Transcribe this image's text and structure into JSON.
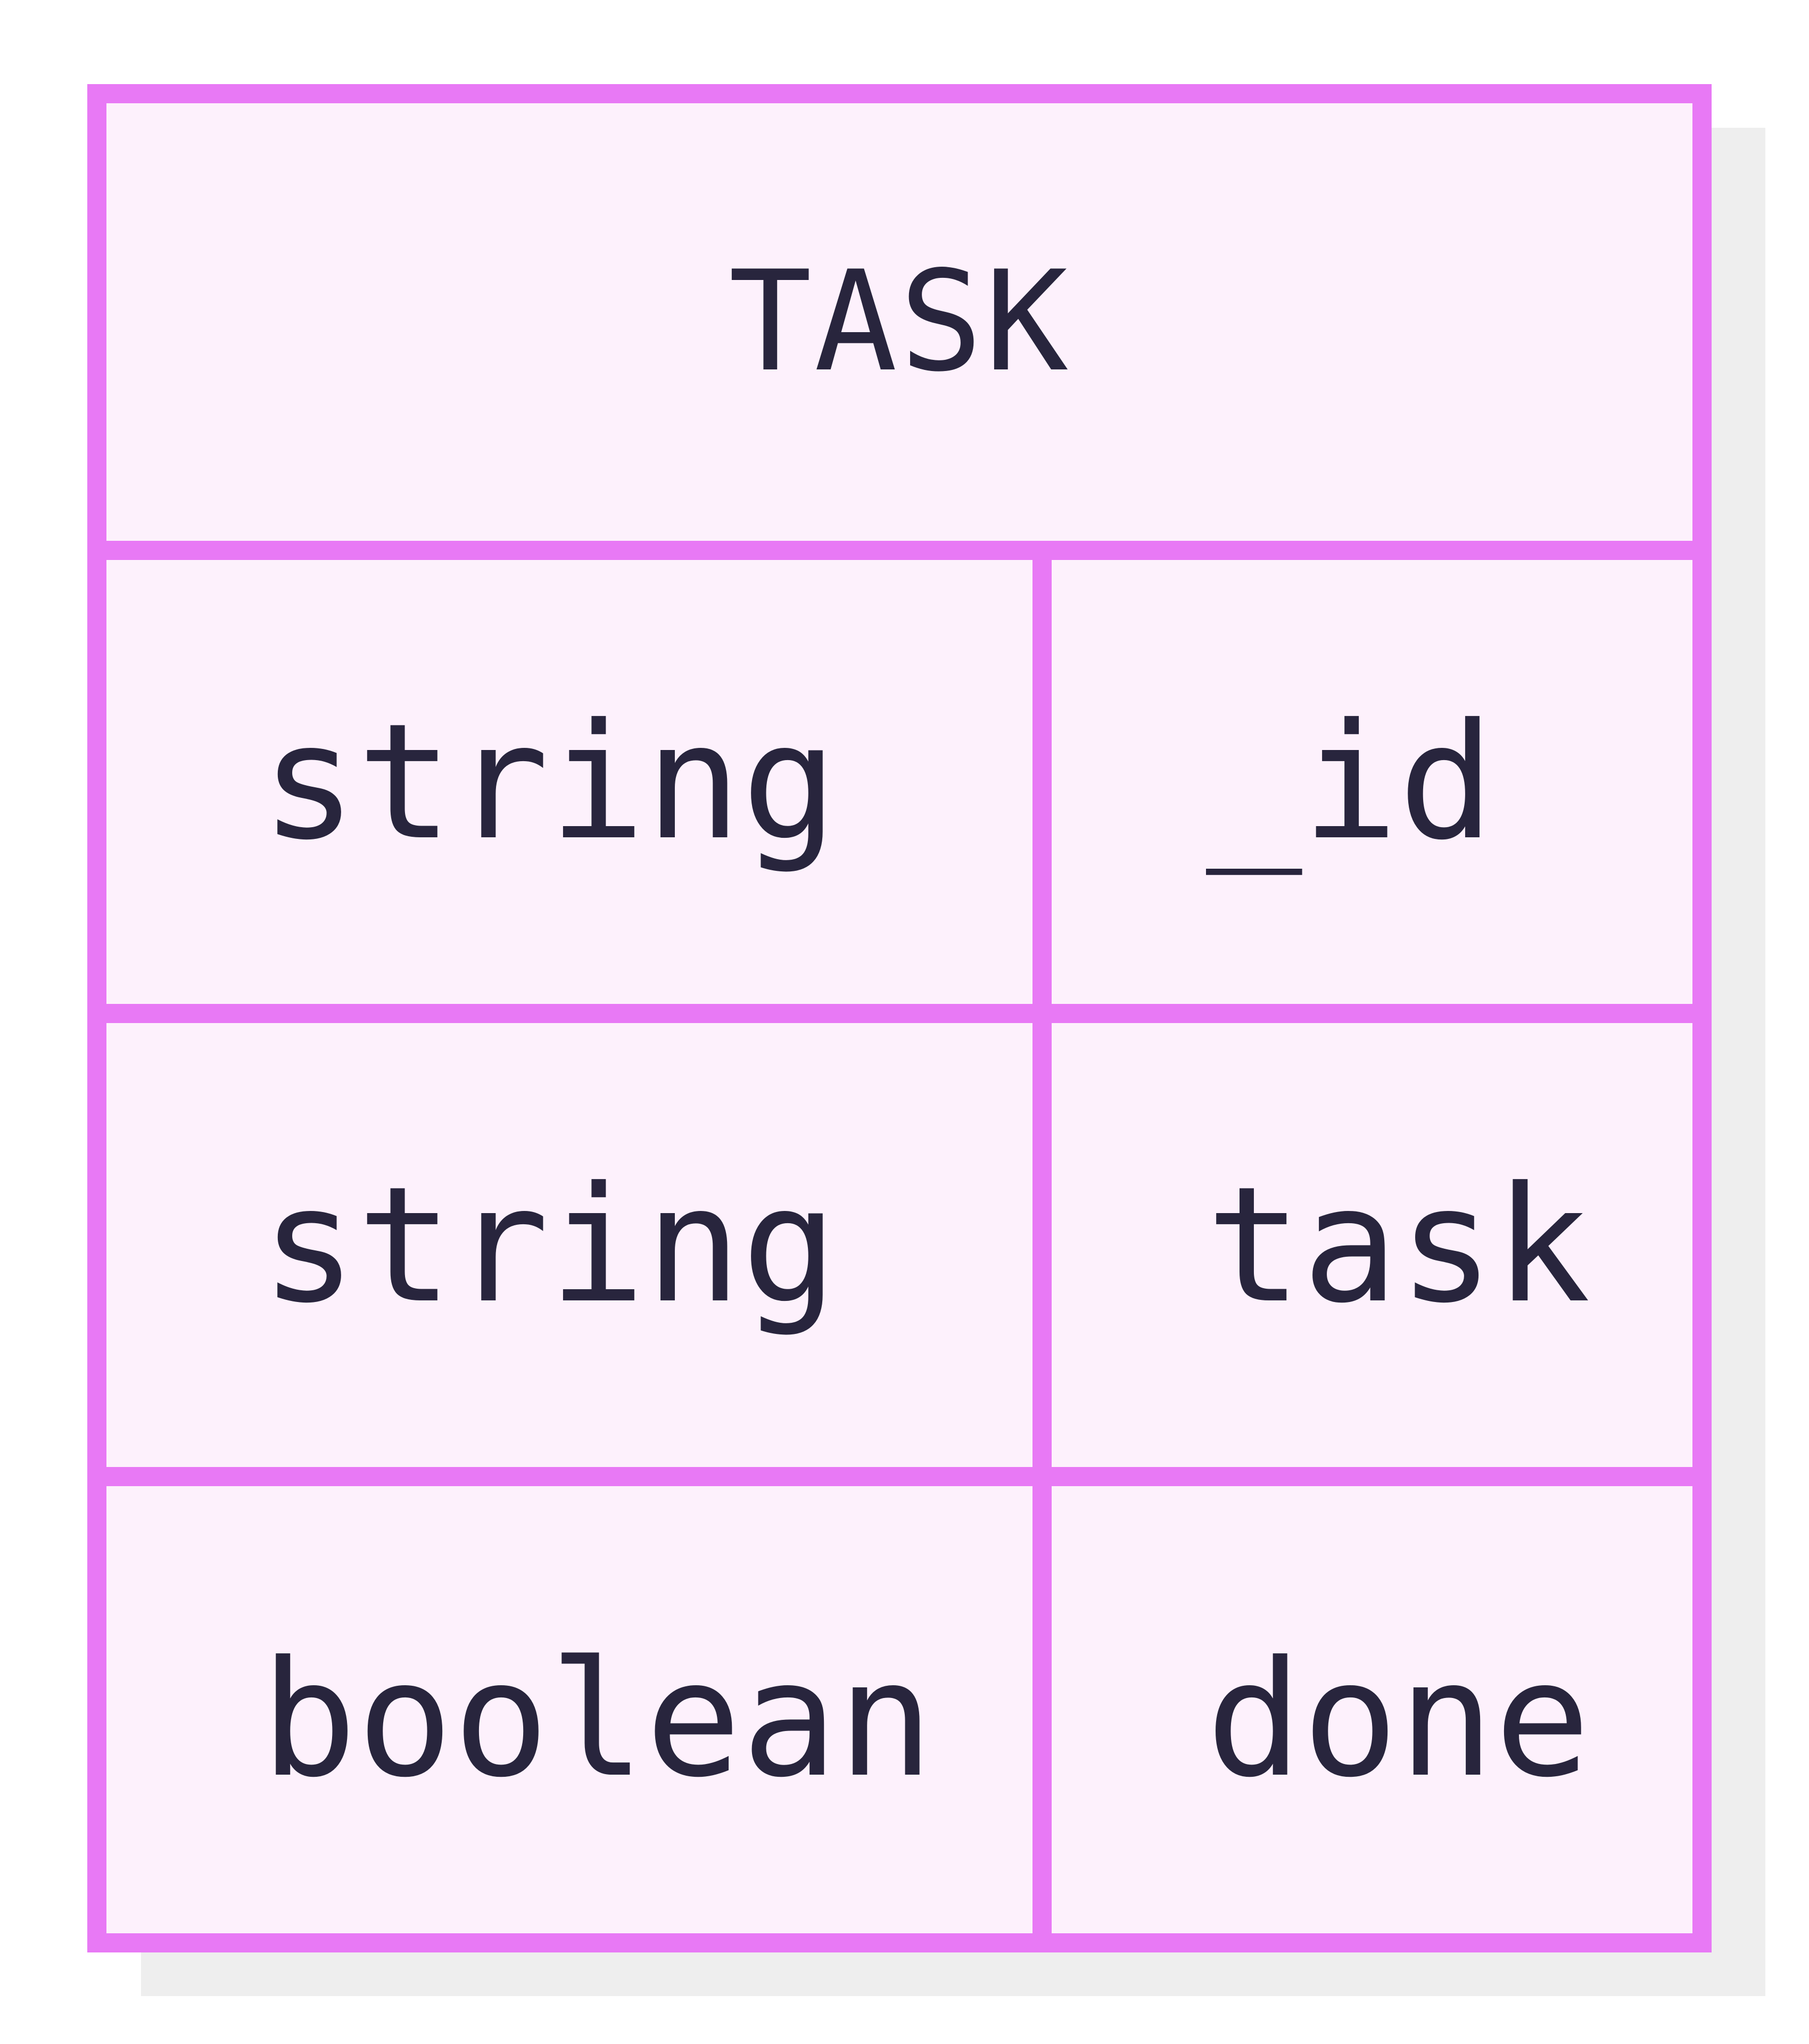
{
  "entity": {
    "name": "TASK",
    "attributes": [
      {
        "type": "string",
        "name": "_id"
      },
      {
        "type": "string",
        "name": "task"
      },
      {
        "type": "boolean",
        "name": "done"
      }
    ]
  },
  "colors": {
    "border": "#e879f5",
    "fill": "#fdf1fc",
    "text": "#28253d",
    "shadow": "#eeeeee"
  }
}
